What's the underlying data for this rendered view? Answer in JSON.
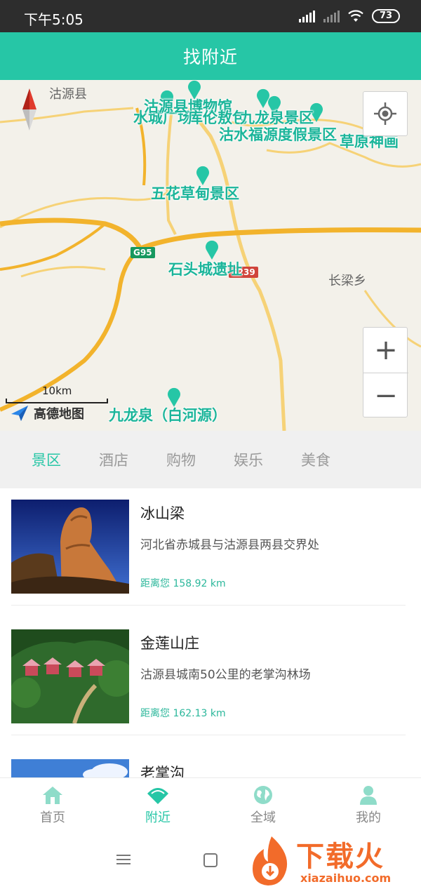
{
  "status_bar": {
    "time": "下午5:05",
    "battery": "73"
  },
  "header": {
    "title": "找附近"
  },
  "map": {
    "town_labels": [
      "沽源县",
      "长梁乡"
    ],
    "poi_labels": [
      "水城广场",
      "沽源县博物馆",
      "库伦敖包",
      "九龙泉景区",
      "沽水福源度假景区",
      "草原神画",
      "五花草甸景区",
      "石头城遗址",
      "九龙泉（白河源）"
    ],
    "road_shields": [
      "G95",
      "S239"
    ],
    "scale_label": "10km",
    "logo_text": "高德地图",
    "zoom_in": "+",
    "zoom_out": "−",
    "colors": {
      "major_road": "#f2b32c",
      "minor_road": "#f6d277",
      "poi": "#1bb59a"
    }
  },
  "category_tabs": [
    "景区",
    "酒店",
    "购物",
    "娱乐",
    "美食"
  ],
  "active_tab": "景区",
  "list": [
    {
      "name": "冰山梁",
      "address": "河北省赤城县与沽源县两县交界处",
      "distance": "距离您 158.92 km"
    },
    {
      "name": "金莲山庄",
      "address": "沽源县城南50公里的老掌沟林场",
      "distance": "距离您 162.13 km"
    },
    {
      "name": "老掌沟",
      "address": "",
      "distance": ""
    }
  ],
  "bottom_nav": [
    {
      "label": "首页",
      "icon": "home-icon"
    },
    {
      "label": "附近",
      "icon": "nearby-icon"
    },
    {
      "label": "全域",
      "icon": "globe-icon"
    },
    {
      "label": "我的",
      "icon": "user-icon"
    }
  ],
  "watermark": {
    "main": "下载火",
    "url": "xiazaihuo.com"
  },
  "accent_color": "#26c6a6"
}
